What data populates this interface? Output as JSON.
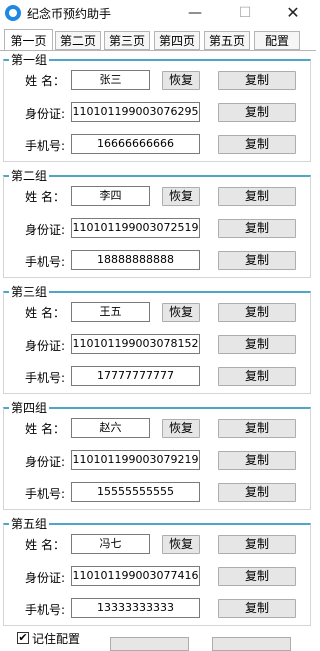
{
  "window": {
    "title": "纪念币预约助手",
    "icon": "app-coin-icon",
    "min_glyph": "—",
    "max_glyph": "☐",
    "close_glyph": "✕"
  },
  "tabs": [
    {
      "label": "第一页",
      "active": true
    },
    {
      "label": "第二页",
      "active": false
    },
    {
      "label": "第三页",
      "active": false
    },
    {
      "label": "第四页",
      "active": false
    },
    {
      "label": "第五页",
      "active": false
    },
    {
      "label": "配置",
      "active": false
    }
  ],
  "labels": {
    "name": "姓 名：",
    "id": "身份证:",
    "phone": "手机号:",
    "restore": "恢复",
    "copy": "复制"
  },
  "groups": [
    {
      "title": "第一组",
      "name": "张三",
      "id": "110101199003076295",
      "phone": "16666666666"
    },
    {
      "title": "第二组",
      "name": "李四",
      "id": "110101199003072519",
      "phone": "18888888888"
    },
    {
      "title": "第三组",
      "name": "王五",
      "id": "110101199003078152",
      "phone": "17777777777"
    },
    {
      "title": "第四组",
      "name": "赵六",
      "id": "110101199003079219",
      "phone": "15555555555"
    },
    {
      "title": "第五组",
      "name": "冯七",
      "id": "110101199003077416",
      "phone": "13333333333"
    }
  ],
  "footer": {
    "remember_label": "记住配置",
    "remember_checked": true,
    "check_glyph": "✔"
  },
  "colors": {
    "accent": "#4fa6c7",
    "button_bg": "#e6e6e6"
  }
}
